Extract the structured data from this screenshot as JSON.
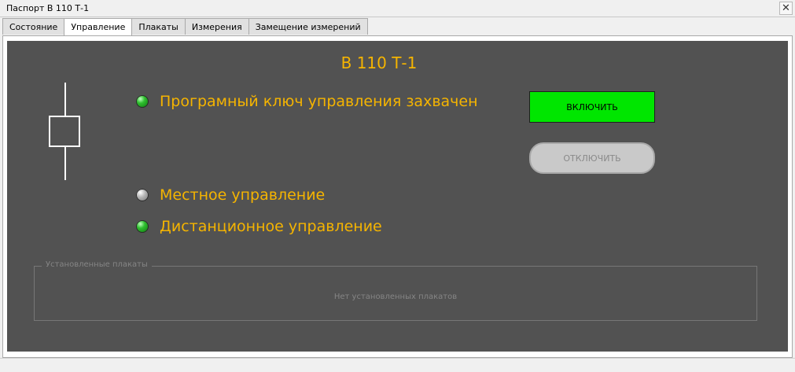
{
  "window": {
    "title": "Паспорт В 110 Т-1",
    "close_symbol": "✕"
  },
  "tabs": [
    {
      "label": "Состояние",
      "active": false
    },
    {
      "label": "Управление",
      "active": true
    },
    {
      "label": "Плакаты",
      "active": false
    },
    {
      "label": "Измерения",
      "active": false
    },
    {
      "label": "Замещение измерений",
      "active": false
    }
  ],
  "panel": {
    "title": "В 110 Т-1",
    "indicators": [
      {
        "label": "Програмный ключ управления захвачен",
        "state": "green"
      },
      {
        "label": "Местное управление",
        "state": "gray"
      },
      {
        "label": "Дистанционное управление",
        "state": "green"
      }
    ],
    "buttons": {
      "on_label": "ВКЛЮЧИТЬ",
      "off_label": "ОТКЛЮЧИТЬ"
    },
    "posters": {
      "legend": "Установленные плакаты",
      "empty_text": "Нет установленных плакатов"
    }
  },
  "colors": {
    "panel_bg": "#525252",
    "accent_text": "#f5b400",
    "on_button": "#00e600",
    "lamp_green": "#2fc02f",
    "lamp_gray": "#b5b5b5"
  }
}
